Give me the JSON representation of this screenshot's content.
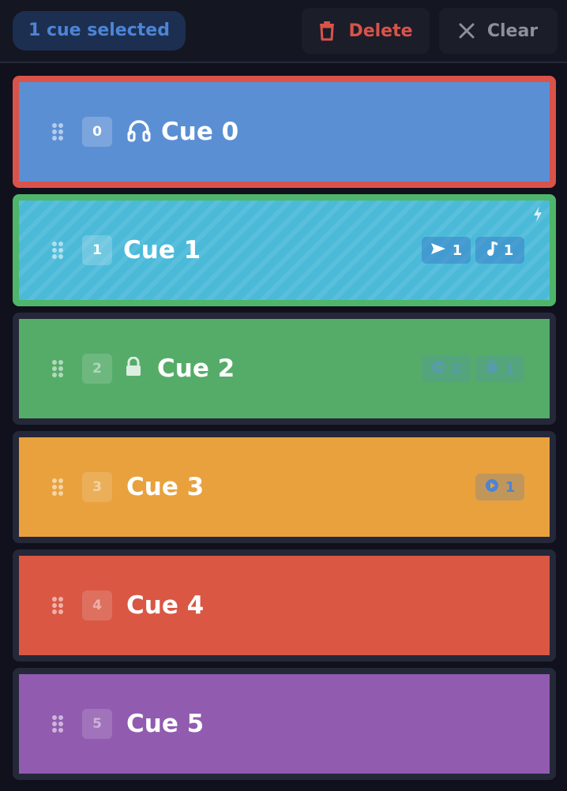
{
  "toolbar": {
    "selection_label": "1 cue selected",
    "delete_label": "Delete",
    "clear_label": "Clear"
  },
  "colors": {
    "selected_border": "#d9534a",
    "active_border": "#4fb56a",
    "accent": "#4c84d6"
  },
  "cues": [
    {
      "index": "0",
      "title": "Cue 0",
      "color": "#5b8fd4",
      "icon": "headphones-icon",
      "state": "selected",
      "badges": []
    },
    {
      "index": "1",
      "title": "Cue 1",
      "color": "#4bbad9",
      "icon": null,
      "state": "active",
      "trigger_icon": "bolt-icon",
      "badges": [
        {
          "icon": "send-icon",
          "count": "1"
        },
        {
          "icon": "music-note-icon",
          "count": "1"
        }
      ]
    },
    {
      "index": "2",
      "title": "Cue 2",
      "color": "#55ac69",
      "icon": "lock-icon",
      "state": "locked",
      "badges": [
        {
          "icon": "play-circle-icon",
          "count": "2"
        },
        {
          "icon": "timer-icon",
          "count": "1"
        }
      ]
    },
    {
      "index": "3",
      "title": "Cue 3",
      "color": "#e8a13d",
      "icon": null,
      "state": "normal",
      "badges": [
        {
          "icon": "play-circle-icon",
          "count": "1"
        }
      ]
    },
    {
      "index": "4",
      "title": "Cue 4",
      "color": "#d95743",
      "icon": null,
      "state": "normal",
      "badges": []
    },
    {
      "index": "5",
      "title": "Cue 5",
      "color": "#915bb0",
      "icon": null,
      "state": "normal",
      "badges": []
    }
  ]
}
